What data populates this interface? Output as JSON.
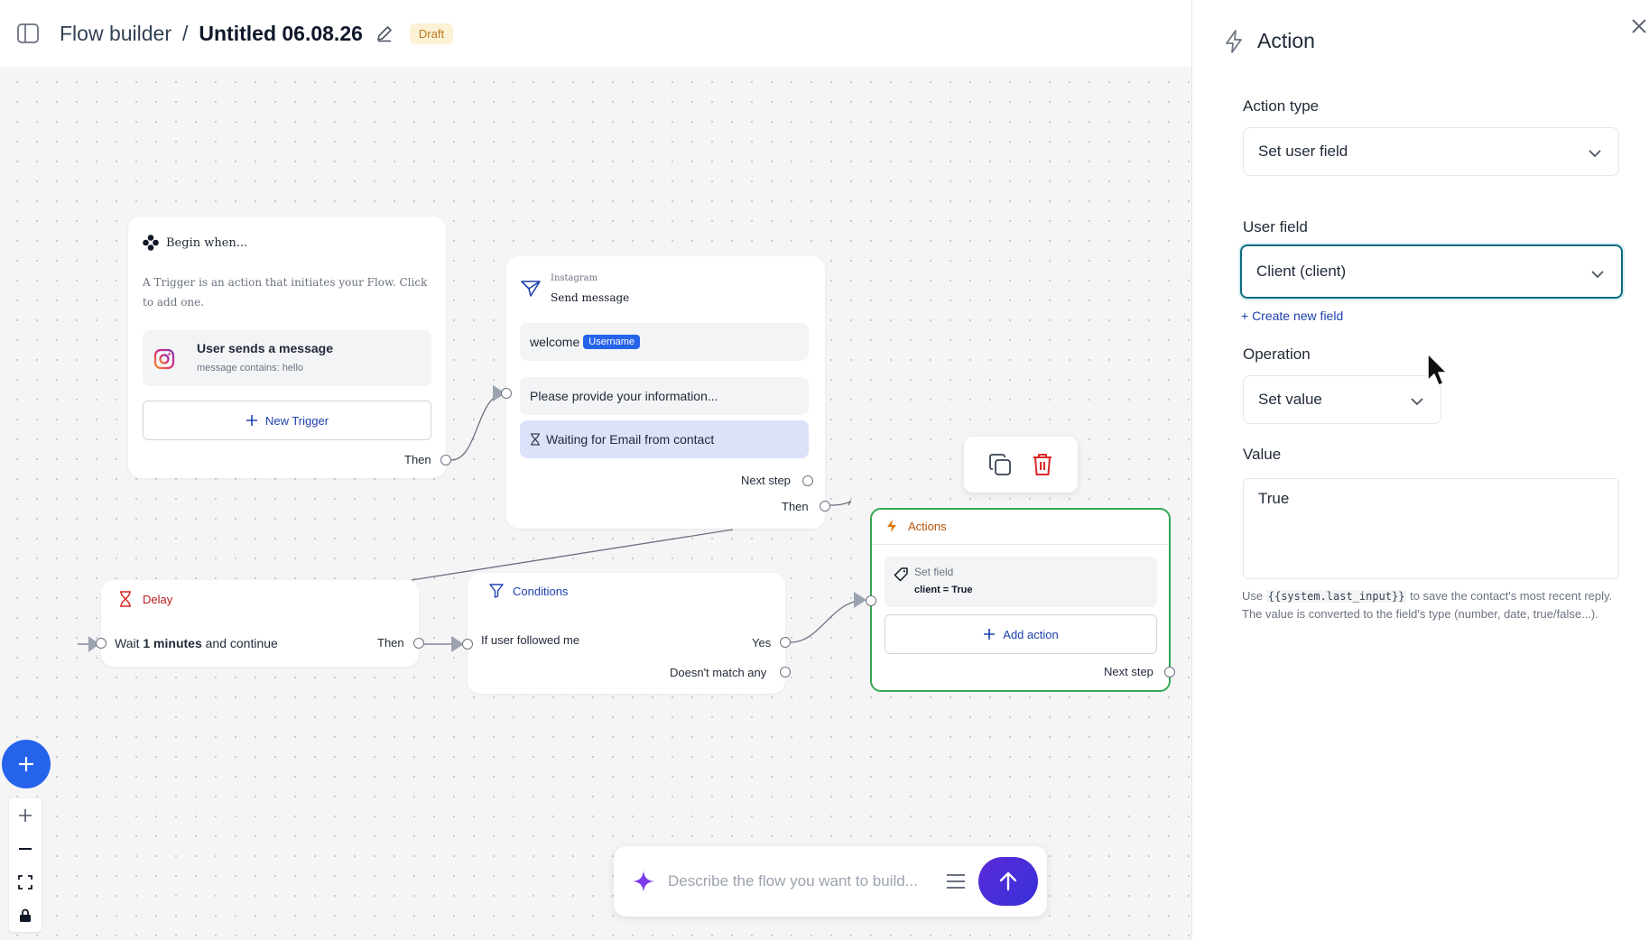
{
  "header": {
    "app_name": "Flow builder",
    "separator": "/",
    "flow_title": "Untitled 06.08.26",
    "status_badge": "Draft"
  },
  "trigger_node": {
    "title": "Begin when...",
    "description": "A Trigger is an action that initiates your Flow. Click to add one.",
    "trigger_title": "User sends a message",
    "trigger_subtitle": "message contains: hello",
    "new_trigger_label": "New Trigger",
    "then_label": "Then"
  },
  "send_node": {
    "channel": "Instagram",
    "title": "Send message",
    "message_text": "welcome",
    "message_chip": "Username",
    "prompt_text": "Please provide your information...",
    "waiting_text": "Waiting for Email from contact",
    "next_step_label": "Next step",
    "then_label": "Then"
  },
  "delay_node": {
    "title": "Delay",
    "body_prefix": "Wait",
    "body_value": "1 minutes",
    "body_suffix": "and continue",
    "then_label": "Then"
  },
  "conditions_node": {
    "title": "Conditions",
    "condition_text": "If user followed me",
    "yes_label": "Yes",
    "no_match_label": "Doesn't match any"
  },
  "actions_node": {
    "title": "Actions",
    "item_label": "Set field",
    "item_value": "client = True",
    "add_action_label": "Add action",
    "next_step_label": "Next step"
  },
  "ai_bar": {
    "placeholder": "Describe the flow you want to build..."
  },
  "panel": {
    "title": "Action",
    "action_type_label": "Action type",
    "action_type_value": "Set user field",
    "user_field_label": "User field",
    "user_field_value": "Client (client)",
    "create_field_link": "+ Create new field",
    "operation_label": "Operation",
    "operation_value": "Set value",
    "value_label": "Value",
    "value_text": "True",
    "help_prefix": "Use",
    "help_code": "{{system.last_input}}",
    "help_suffix": "to save the contact's most recent reply. The value is converted to the field's type (number, date, true/false...)."
  },
  "colors": {
    "accent_blue": "#2563eb",
    "selected_node_border": "#34a853",
    "focus_ring": "#0f6b7f",
    "draft_badge_bg": "#fdf1d6",
    "delete_red": "#dc2626"
  }
}
